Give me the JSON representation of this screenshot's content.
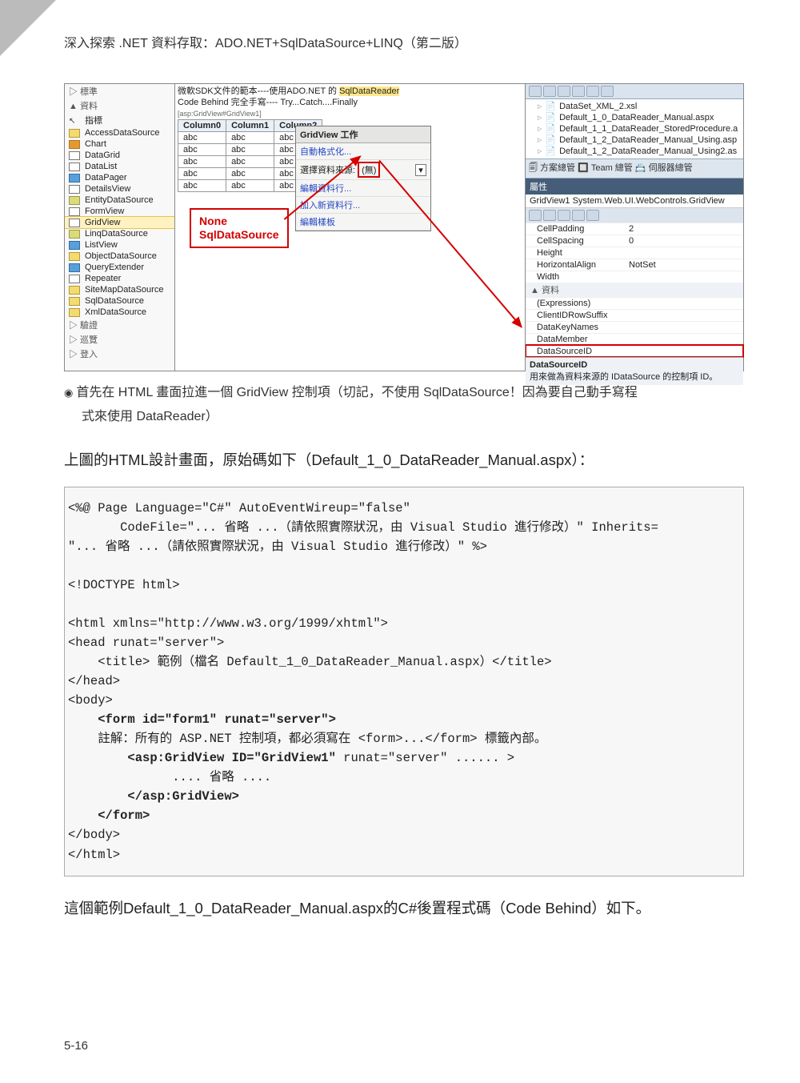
{
  "page_header": "深入探索 .NET 資料存取：ADO.NET+SqlDataSource+LINQ（第二版）",
  "page_number": "5-16",
  "toolbox": {
    "sec_standard": "▷ 標準",
    "sec_data": "▲ 資料",
    "sec_drive": "▷ 驗證",
    "sec_view": "▷ 巡覽",
    "sec_login": "▷ 登入",
    "items": [
      "指標",
      "AccessDataSource",
      "Chart",
      "DataGrid",
      "DataList",
      "DataPager",
      "DetailsView",
      "EntityDataSource",
      "FormView",
      "GridView",
      "LinqDataSource",
      "ListView",
      "ObjectDataSource",
      "QueryExtender",
      "Repeater",
      "SiteMapDataSource",
      "SqlDataSource",
      "XmlDataSource"
    ]
  },
  "designer": {
    "title_l1": "微軟SDK文件的範本----使用ADO.NET 的 ",
    "title_hi": "SqlDataReader",
    "title_l2": "Code Behind 完全手寫---- Try...Catch....Finally",
    "tag": "[asp:GridView#GridView1]",
    "cols": [
      "Column0",
      "Column1",
      "Column2"
    ],
    "cell": "abc"
  },
  "callout": {
    "l1": "None",
    "l2": "SqlDataSource"
  },
  "smart": {
    "title": "GridView 工作",
    "auto": "自動格式化...",
    "pick_l": "選擇資料來源:",
    "pick_v": "(無)",
    "editRows": "編輯資料行...",
    "addRow": "加入新資料行...",
    "editTpl": "編輯樣板"
  },
  "soln": {
    "f0": "DataSet_XML_2.xsl",
    "f1": "Default_1_0_DataReader_Manual.aspx",
    "f2": "Default_1_1_DataReader_StoredProcedure.a",
    "f3": "Default_1_2_DataReader_Manual_Using.asp",
    "f4": "Default_1_2_DataReader_Manual_Using2.as",
    "bar": "🗐 方案總管  🔲 Team 總管  📇 伺服器總管"
  },
  "props": {
    "title": "屬性",
    "type": "GridView1 System.Web.UI.WebControls.GridView",
    "rows": [
      {
        "k": "CellPadding",
        "v": "2"
      },
      {
        "k": "CellSpacing",
        "v": "0"
      },
      {
        "k": "Height",
        "v": ""
      },
      {
        "k": "HorizontalAlign",
        "v": "NotSet"
      },
      {
        "k": "Width",
        "v": ""
      }
    ],
    "cat": "▲ 資料",
    "rows2": [
      {
        "k": "(Expressions)",
        "v": ""
      },
      {
        "k": "ClientIDRowSuffix",
        "v": ""
      },
      {
        "k": "DataKeyNames",
        "v": ""
      },
      {
        "k": "DataMember",
        "v": ""
      },
      {
        "k": "DataSourceID",
        "v": ""
      }
    ],
    "desc_t": "DataSourceID",
    "desc_v": "用來做為資料來源的 IDataSource 的控制項 ID。"
  },
  "caption": {
    "l1": "首先在 HTML 畫面拉進一個 GridView 控制項（切記，不使用 SqlDataSource！因為要自己動手寫程",
    "l2": "式來使用 DataReader）"
  },
  "para1": "上圖的HTML設計畫面，原始碼如下（Default_1_0_DataReader_Manual.aspx）：",
  "code": "<%@ Page Language=\"C#\" AutoEventWireup=\"false\"\n       CodeFile=\"... 省略 ...（請依照實際狀況，由 Visual Studio 進行修改）\" Inherits=\n\"... 省略 ...（請依照實際狀況，由 Visual Studio 進行修改）\" %>\n\n<!DOCTYPE html>\n\n<html xmlns=\"http://www.w3.org/1999/xhtml\">\n<head runat=\"server\">\n    <title> 範例（檔名 Default_1_0_DataReader_Manual.aspx）</title>\n</head>\n<body>\n    <b><form id=\"form1\" runat=\"server\"></b>\n    註解：所有的 ASP.NET 控制項，都必須寫在 <form>...</form> 標籤內部。\n        <b><asp:GridView ID=\"GridView1\"</b> runat=\"server\" ...... >\n              .... 省略 ....\n        <b></asp:GridView></b>\n    <b></form></b>\n</body>\n</html>",
  "para2": "這個範例Default_1_0_DataReader_Manual.aspx的C#後置程式碼（Code Behind）如下。"
}
